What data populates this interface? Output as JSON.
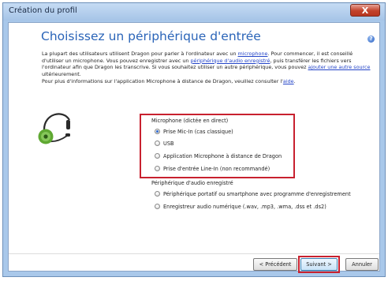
{
  "window": {
    "title": "Création du profil",
    "close_glyph": "X"
  },
  "page": {
    "heading": "Choisissez un périphérique d'entrée",
    "help_glyph": "?",
    "intro": {
      "p1_a": "La plupart des utilisateurs utilisent Dragon pour parler à l'ordinateur avec un ",
      "p1_link1": "microphone",
      "p1_b": ". Pour commencer, il est conseillé d'utiliser un microphone. Vous pouvez enregistrer avec un ",
      "p1_link2": "périphérique d'audio enregistré",
      "p1_c": ", puis transférer les fichiers vers l'ordinateur afin que Dragon les transcrive. Si vous souhaitez utiliser un autre périphérique, vous pouvez ",
      "p1_link3": "ajouter une autre source",
      "p1_d": " ultérieurement.",
      "p2_a": "Pour plus d'informations sur l'application Microphone à distance de Dragon, veuillez consulter l'",
      "p2_link": "aide",
      "p2_b": "."
    }
  },
  "microphone_group": {
    "label": "Microphone (dictée en direct)",
    "options": [
      {
        "label": "Prise Mic-In (cas classique)",
        "selected": true
      },
      {
        "label": "USB",
        "selected": false
      },
      {
        "label": "Application Microphone à distance de Dragon",
        "selected": false
      },
      {
        "label": "Prise d'entrée Line-In (non recommandé)",
        "selected": false
      }
    ]
  },
  "recorded_group": {
    "label": "Périphérique d'audio enregistré",
    "options": [
      {
        "label": "Périphérique portatif ou smartphone avec programme d'enregistrement",
        "selected": false
      },
      {
        "label": "Enregistreur audio numérique (.wav, .mp3, .wma, .dss et .ds2)",
        "selected": false
      }
    ]
  },
  "buttons": {
    "previous": "< Précédent",
    "next": "Suivant >",
    "cancel": "Annuler"
  },
  "colors": {
    "heading": "#2a64b8",
    "highlight_box": "#c8212f",
    "link": "#2344c8",
    "headset_green": "#5fa832",
    "close_button": "#c2412a"
  },
  "icons": {
    "headset": "headset-icon",
    "help": "help-icon",
    "close": "close-icon"
  }
}
